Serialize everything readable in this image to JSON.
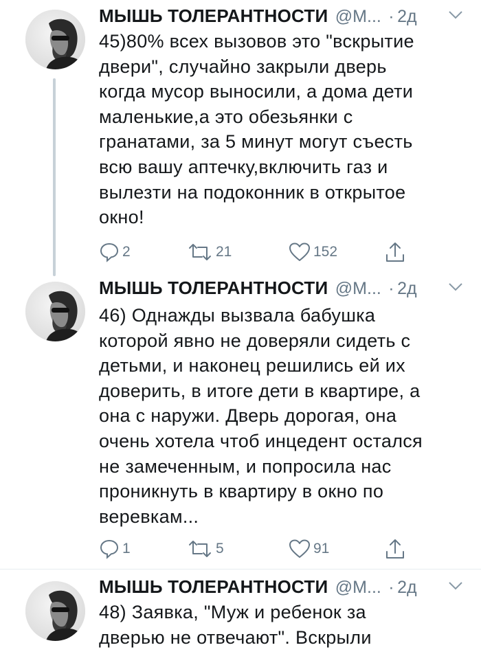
{
  "tweets": [
    {
      "name": "МЫШЬ ТОЛЕРАНТНОСТИ",
      "handle": "@М...",
      "separator": "·",
      "time": "2д",
      "lines": [
        "45)80% всех вызовов это \"вскрытие",
        "двери\", случайно закрыли дверь",
        "когда мусор выносили, а дома дети",
        "маленькие,а это обезьянки с",
        "гранатами, за 5 минут могут съесть",
        "всю вашу аптечку,включить газ и",
        "вылезти на подоконник в открытое",
        "окно!"
      ],
      "replies": "2",
      "retweets": "21",
      "likes": "152"
    },
    {
      "name": "МЫШЬ ТОЛЕРАНТНОСТИ",
      "handle": "@М...",
      "separator": "·",
      "time": "2д",
      "lines": [
        "46) Однажды вызвала бабушка",
        "которой явно не доверяли сидеть с",
        "детьми, и наконец решились ей их",
        "доверить, в итоге дети в квартире, а",
        "она с наружи. Дверь дорогая, она",
        "очень хотела чтоб инцедент остался",
        "не замеченным, и попросила нас",
        "проникнуть в квартиру в окно по",
        "веревкам..."
      ],
      "replies": "1",
      "retweets": "5",
      "likes": "91"
    },
    {
      "name": "МЫШЬ ТОЛЕРАНТНОСТИ",
      "handle": "@М...",
      "separator": "·",
      "time": "2д",
      "lines": [
        "48) Заявка, \"Муж и ребенок за",
        "дверью не отвечают\". Вскрыли"
      ]
    }
  ],
  "colors": {
    "text": "#14171a",
    "secondary": "#657786",
    "thread_line": "#c7d1d8",
    "divider": "#e6ecf0"
  },
  "icons": [
    "avatar",
    "chevron-down-icon",
    "reply-icon",
    "retweet-icon",
    "like-icon",
    "share-icon"
  ]
}
